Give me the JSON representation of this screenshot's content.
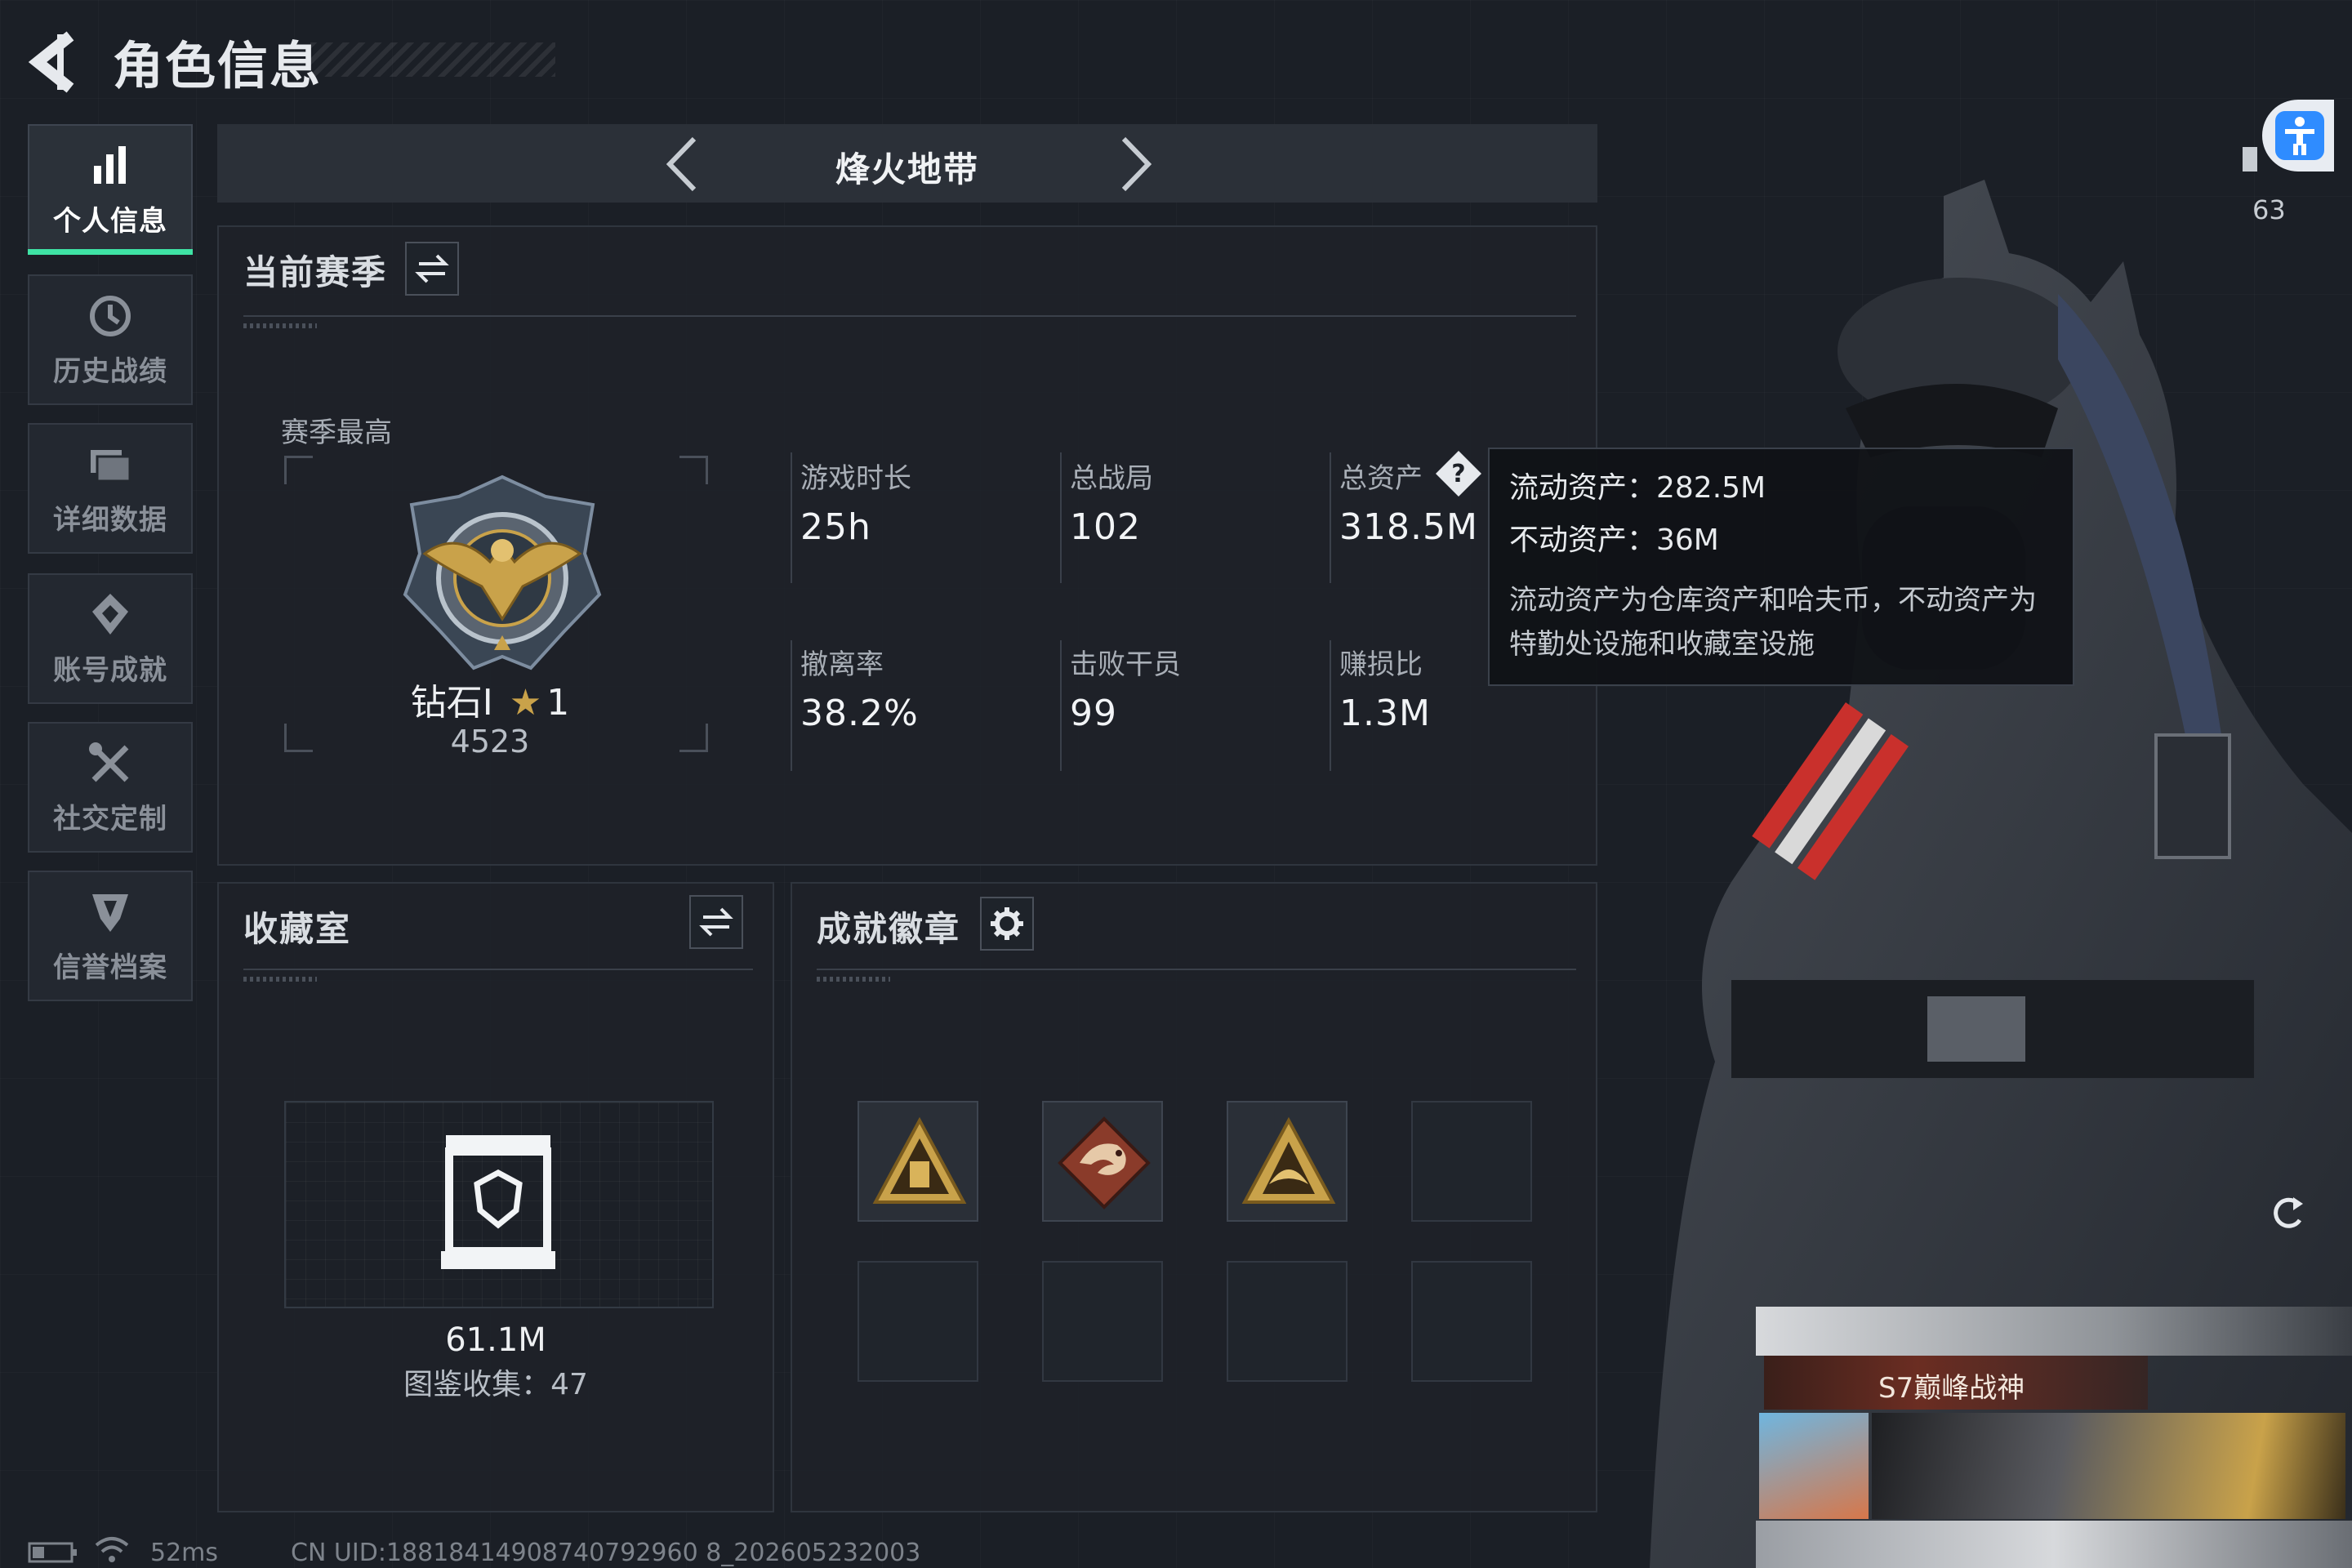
{
  "header": {
    "title": "角色信息"
  },
  "sidebar": {
    "items": [
      {
        "label": "个人信息",
        "icon": "bar-chart-icon",
        "active": true
      },
      {
        "label": "历史战绩",
        "icon": "clock-icon"
      },
      {
        "label": "详细数据",
        "icon": "folder-icon"
      },
      {
        "label": "账号成就",
        "icon": "medal-icon"
      },
      {
        "label": "社交定制",
        "icon": "tools-icon"
      },
      {
        "label": "信誉档案",
        "icon": "shield-icon"
      }
    ]
  },
  "mode": {
    "title": "烽火地带"
  },
  "season": {
    "title": "当前赛季",
    "best_label": "赛季最高",
    "rank_name": "钻石I",
    "rank_star": "★",
    "rank_level": "1",
    "rank_points": "4523",
    "stats": [
      {
        "label": "游戏时长",
        "value": "25h"
      },
      {
        "label": "总战局",
        "value": "102"
      },
      {
        "label": "总资产",
        "value": "318.5M"
      },
      {
        "label": "撤离率",
        "value": "38.2%"
      },
      {
        "label": "击败干员",
        "value": "99"
      },
      {
        "label": "赚损比",
        "value": "1.3M"
      }
    ]
  },
  "tooltip": {
    "liquid": "流动资产：282.5M",
    "fixed": "不动资产：36M",
    "desc": "流动资产为仓库资产和哈夫币，不动资产为特勤处设施和收藏室设施"
  },
  "collection": {
    "title": "收藏室",
    "value": "61.1M",
    "catalog": "图鉴收集：47"
  },
  "badges": {
    "title": "成就徽章",
    "filled": 3,
    "total": 8
  },
  "right": {
    "counter": "63",
    "season_badge": "S7巅峰战神"
  },
  "status": {
    "ping": "52ms",
    "uid": "CN UID:18818414908740792960 8_202605232003"
  },
  "colors": {
    "accent": "#3fe3a5",
    "help_blue": "#2f8cff",
    "gold": "#c9a24a"
  }
}
